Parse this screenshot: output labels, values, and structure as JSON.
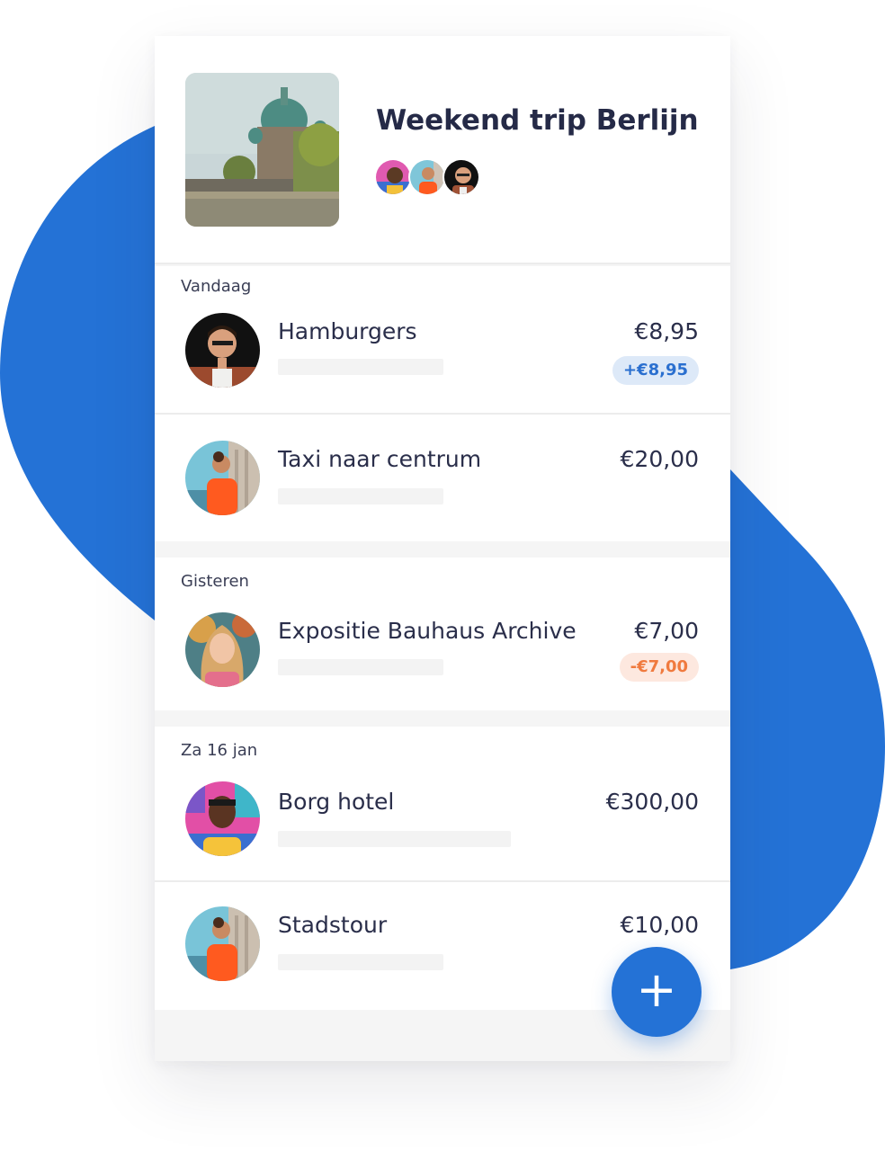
{
  "colors": {
    "accent": "#2472d6",
    "positive_bg": "#dde9f8",
    "positive_text": "#2a6fcf",
    "negative_bg": "#fde8df",
    "negative_text": "#f07a3e"
  },
  "trip": {
    "title": "Weekend trip Berlijn",
    "cover_icon": "berlin-cathedral-photo",
    "members": [
      "member-avatar-1",
      "member-avatar-2",
      "member-avatar-3"
    ]
  },
  "sections": [
    {
      "label": "Vandaag",
      "items": [
        {
          "name": "Hamburgers",
          "amount": "€8,95",
          "balance": "+€8,95"
        },
        {
          "name": "Taxi naar centrum",
          "amount": "€20,00"
        }
      ]
    },
    {
      "label": "Gisteren",
      "items": [
        {
          "name": "Expositie Bauhaus Archive",
          "amount": "€7,00",
          "balance": "-€7,00"
        }
      ]
    },
    {
      "label": "Za 16 jan",
      "items": [
        {
          "name": "Borg hotel",
          "amount": "€300,00"
        },
        {
          "name": "Stadstour",
          "amount": "€10,00"
        }
      ]
    }
  ],
  "fab": {
    "label": "+",
    "icon": "plus-icon"
  }
}
